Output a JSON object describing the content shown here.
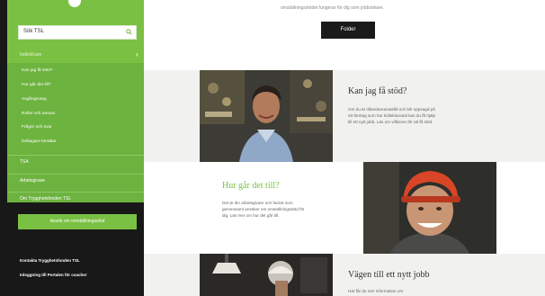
{
  "sidebar": {
    "search_placeholder": "Sök TSL",
    "section_label": "Individcare",
    "sub_items": [
      {
        "label": "Kan jag få stöd?"
      },
      {
        "label": "Hur går det till?"
      },
      {
        "label": "Avgångsvtag"
      },
      {
        "label": "Roller och ansvar"
      },
      {
        "label": "Frågor och svar"
      },
      {
        "label": "Deltagare berättar"
      }
    ],
    "main_items": [
      {
        "label": "TSA"
      },
      {
        "label": "Arbetsgivare"
      },
      {
        "label": "Om Trygghetsfonden TSL"
      }
    ],
    "cta_label": "Ansök om omställningsstöd",
    "footer_links": [
      {
        "label": "Kontakta Trygghetsfonden TSL"
      },
      {
        "label": "Inloggning till Portalen för coacher"
      }
    ]
  },
  "main": {
    "top_text": "omställningsstödet fungerar för dig som jobbsökare.",
    "folder_button": "Folder",
    "cards": [
      {
        "title": "Kan jag få stöd?",
        "body": [
          "Om du är tillsvidareanställd och blir uppsagd på",
          "ett företag som har kollektivavtal kan du få hjälp",
          "till ett nytt jobb. Läs om villkoren för att få stöd."
        ]
      },
      {
        "title": "Hur går det till?",
        "body": [
          "Det är din arbetsgivare och facket som",
          "gemensamt ansöker om omställningsstöd för",
          "dig. Läs mer om hur det går till."
        ]
      },
      {
        "title": "Vägen till ett nytt jobb",
        "body": [
          "Här får du mer information om"
        ]
      }
    ]
  },
  "colors": {
    "sidebar_green": "#6db33f",
    "accent_green": "#7ac143",
    "dark": "#181818",
    "title_green": "#7ac143"
  }
}
